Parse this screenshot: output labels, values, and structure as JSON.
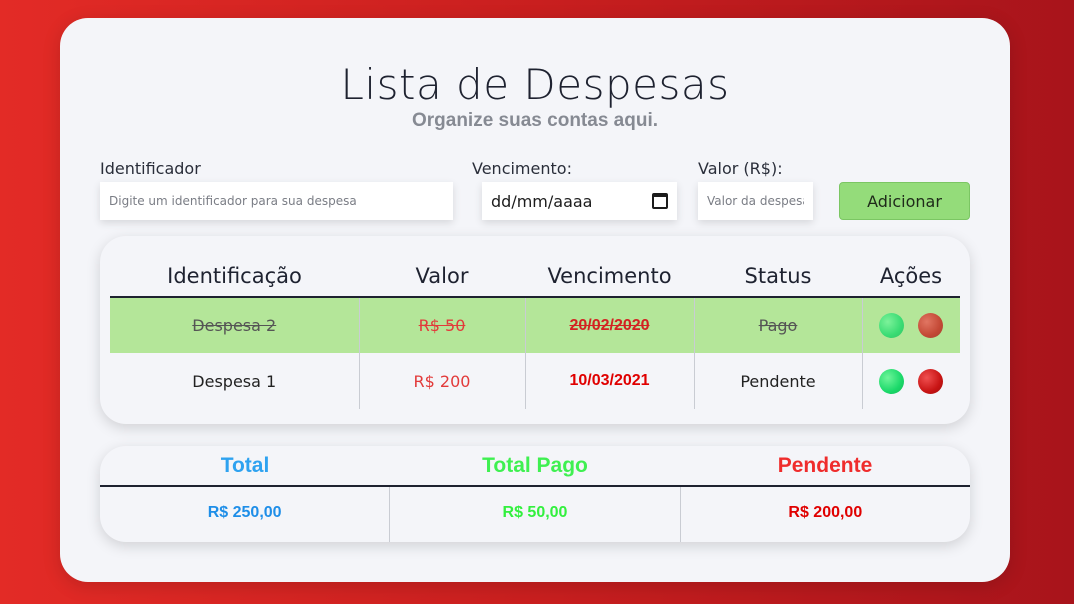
{
  "header": {
    "title": "Lista de Despesas",
    "subtitle": "Organize suas contas aqui."
  },
  "form": {
    "id_label": "Identificador",
    "id_placeholder": "Digite um identificador para sua despesa",
    "due_label": "Vencimento:",
    "due_value": "dd/mm/aaaa",
    "value_label": "Valor (R$):",
    "value_placeholder": "Valor da despesa",
    "add_button": "Adicionar"
  },
  "list": {
    "columns": [
      "Identificação",
      "Valor",
      "Vencimento",
      "Status",
      "Ações"
    ],
    "rows": [
      {
        "name": "Despesa 2",
        "value": "R$ 50",
        "due": "20/02/2020",
        "status": "Pago",
        "paid": true
      },
      {
        "name": "Despesa 1",
        "value": "R$ 200",
        "due": "10/03/2021",
        "status": "Pendente",
        "paid": false
      }
    ]
  },
  "totals": {
    "total_label": "Total",
    "paid_label": "Total Pago",
    "pending_label": "Pendente",
    "total_value": "R$ 250,00",
    "paid_value": "R$ 50,00",
    "pending_value": "R$ 200,00"
  },
  "colors": {
    "background": "#d42424",
    "paid_row": "#b4e699",
    "add_button": "#94dc7a",
    "total": "#2ea2f0",
    "paid": "#3ff051",
    "pending": "#ef2c2c"
  },
  "icons": {
    "confirm": "green-circle-icon",
    "delete": "red-circle-icon",
    "date_picker": "calendar-icon"
  }
}
